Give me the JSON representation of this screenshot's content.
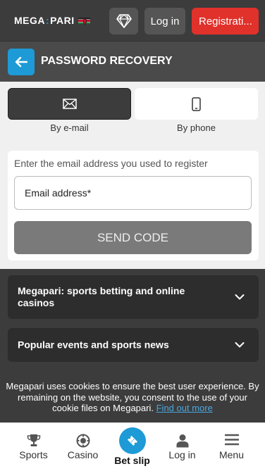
{
  "header": {
    "logo_left": "MEGA",
    "logo_sep": ":",
    "logo_right": "PARI",
    "login_label": "Log in",
    "register_label": "Registrati..."
  },
  "titlebar": {
    "title": "PASSWORD RECOVERY"
  },
  "tabs": [
    {
      "label": "By e-mail",
      "icon": "envelope-icon",
      "active": true
    },
    {
      "label": "By phone",
      "icon": "phone-icon",
      "active": false
    }
  ],
  "form": {
    "hint": "Enter the email address you used to register",
    "email_placeholder": "Email address*",
    "send_label": "SEND CODE"
  },
  "accordions": [
    {
      "label": "Megapari: sports betting and online casinos"
    },
    {
      "label": "Popular events and sports news"
    }
  ],
  "cookie": {
    "text": "Megapari uses cookies to ensure the best user experience. By remaining on the website, you consent to the use of your cookie files on Megapari.",
    "link": "Find out more"
  },
  "bottom_nav": [
    {
      "label": "Sports",
      "icon": "trophy-icon"
    },
    {
      "label": "Casino",
      "icon": "casino-chip-icon"
    },
    {
      "label": "Bet slip",
      "icon": "ticket-icon"
    },
    {
      "label": "Log in",
      "icon": "user-icon"
    },
    {
      "label": "Menu",
      "icon": "menu-icon"
    }
  ],
  "colors": {
    "accent_blue": "#1e9ad6",
    "register_red": "#e0312b",
    "dark_bg": "#3c3c3c"
  }
}
